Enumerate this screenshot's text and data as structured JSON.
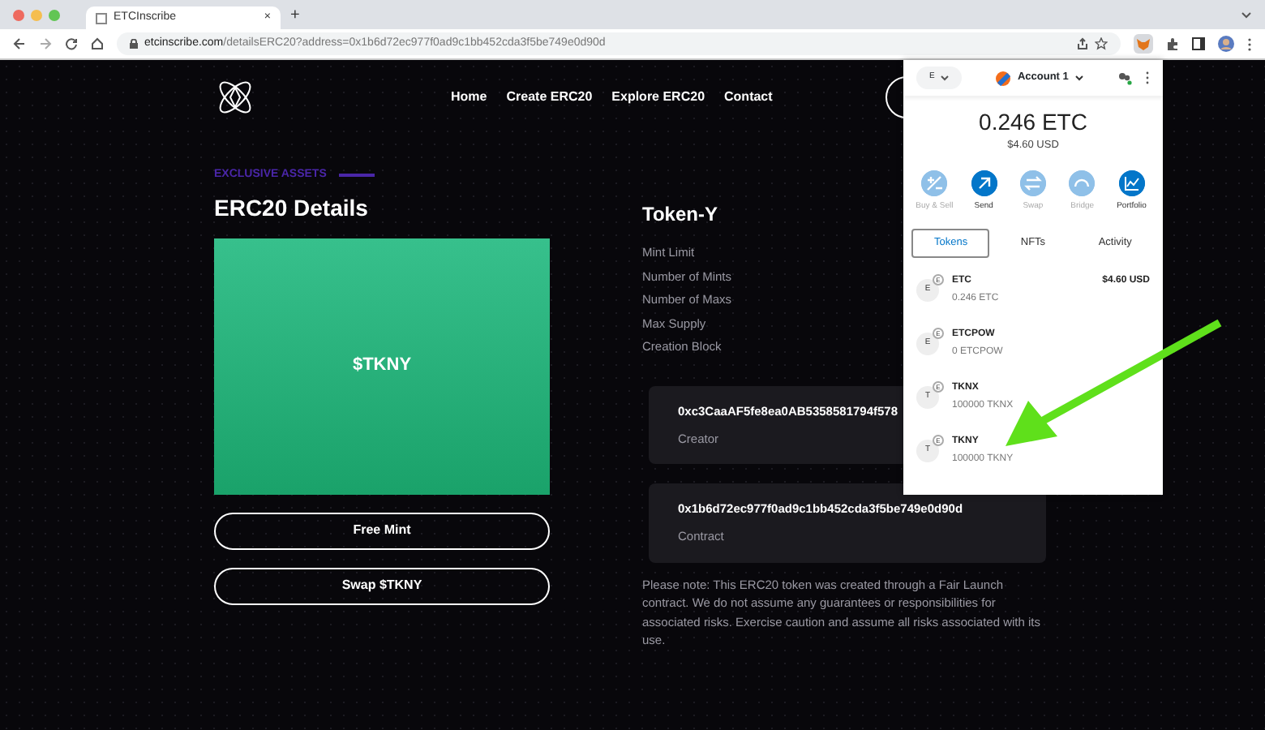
{
  "browser": {
    "tab_title": "ETCInscribe",
    "tab_close": "×",
    "new_tab": "+",
    "url_host": "etcinscribe.com",
    "url_path": "/detailsERC20?address=0x1b6d72ec977f0ad9c1bb452cda3f5be749e0d90d"
  },
  "site": {
    "nav_links": [
      "Home",
      "Create ERC20",
      "Explore ERC20",
      "Contact"
    ],
    "eyebrow": "EXCLUSIVE ASSETS",
    "heading": "ERC20 Details",
    "token_image_label": "$TKNY",
    "buttons": [
      "Free Mint",
      "Swap $TKNY"
    ],
    "token_name": "Token-Y",
    "fields": [
      "Mint Limit",
      "Number of Mints",
      "Number of Maxs",
      "Max Supply",
      "Creation Block"
    ],
    "addresses": [
      {
        "value": "0xc3CaaAF5fe8ea0AB5358581794f578",
        "label": "Creator"
      },
      {
        "value": "0x1b6d72ec977f0ad9c1bb452cda3f5be749e0d90d",
        "label": "Contract"
      }
    ],
    "note": "Please note: This ERC20 token was created through a Fair Launch contract. We do not assume any guarantees or responsibilities for associated risks. Exercise caution and assume all risks associated with its use."
  },
  "wallet": {
    "network": "E",
    "account": "Account 1",
    "balance": "0.246 ETC",
    "fiat": "$4.60 USD",
    "actions": [
      {
        "label": "Buy & Sell",
        "disabled": true
      },
      {
        "label": "Send",
        "disabled": false
      },
      {
        "label": "Swap",
        "disabled": true
      },
      {
        "label": "Bridge",
        "disabled": true
      },
      {
        "label": "Portfolio",
        "disabled": false
      }
    ],
    "tabs": [
      {
        "label": "Tokens",
        "selected": true
      },
      {
        "label": "NFTs",
        "selected": false
      },
      {
        "label": "Activity",
        "selected": false
      }
    ],
    "tokens": [
      {
        "letter": "E",
        "badge": "E",
        "name": "ETC",
        "amount": "0.246 ETC",
        "fiat": "$4.60 USD"
      },
      {
        "letter": "E",
        "badge": "E",
        "name": "ETCPOW",
        "amount": "0 ETCPOW"
      },
      {
        "letter": "T",
        "badge": "E",
        "name": "TKNX",
        "amount": "100000 TKNX"
      },
      {
        "letter": "T",
        "badge": "E",
        "name": "TKNY",
        "amount": "100000 TKNY"
      }
    ]
  }
}
